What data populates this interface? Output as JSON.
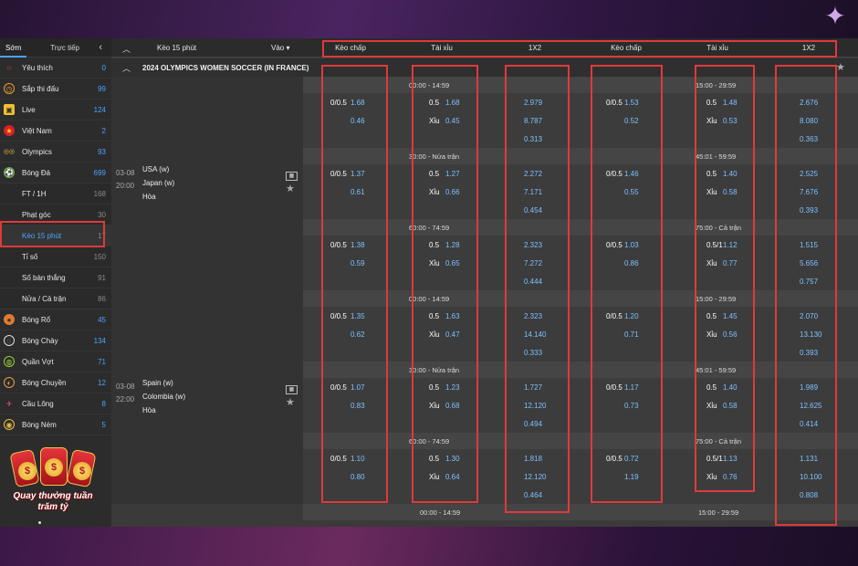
{
  "sidebar": {
    "tabs": [
      "Sớm",
      "Trực tiếp"
    ],
    "items": [
      {
        "label": "Yêu thích",
        "count": "0",
        "icon": "star-icon"
      },
      {
        "label": "Sắp thi đấu",
        "count": "99",
        "icon": "clock-icon"
      },
      {
        "label": "Live",
        "count": "124",
        "icon": "tv-icon"
      },
      {
        "label": "Việt Nam",
        "count": "2",
        "icon": "vietnam-flag-icon"
      },
      {
        "label": "Olympics",
        "count": "93",
        "icon": "olympic-rings-icon"
      },
      {
        "label": "Bóng Đá",
        "count": "699",
        "icon": "soccer-ball-icon"
      }
    ],
    "sub_items": [
      {
        "label": "FT / 1H",
        "count": "168"
      },
      {
        "label": "Phạt góc",
        "count": "30"
      },
      {
        "label": "Kèo 15 phút",
        "count": "17"
      },
      {
        "label": "Tỉ số",
        "count": "150"
      },
      {
        "label": "Số bàn thắng",
        "count": "91"
      },
      {
        "label": "Nửa / Cả trận",
        "count": "86"
      }
    ],
    "sports": [
      {
        "label": "Bóng Rổ",
        "count": "45",
        "icon": "basketball-icon"
      },
      {
        "label": "Bóng Chày",
        "count": "134",
        "icon": "baseball-icon"
      },
      {
        "label": "Quần Vợt",
        "count": "71",
        "icon": "tennis-icon"
      },
      {
        "label": "Bóng Chuyền",
        "count": "12",
        "icon": "volleyball-icon"
      },
      {
        "label": "Cầu Lông",
        "count": "8",
        "icon": "badminton-icon"
      },
      {
        "label": "Bóng Ném",
        "count": "5",
        "icon": "handball-icon"
      }
    ]
  },
  "promo": {
    "line1": "Quay thưởng tuần",
    "line2": "trăm tỷ"
  },
  "topbar": {
    "title": "Kèo 15 phút",
    "vao": "Vào",
    "columns": [
      "Kèo chấp",
      "Tài xỉu",
      "1X2",
      "Kèo chấp",
      "Tài xỉu",
      "1X2"
    ]
  },
  "league": "2024 OLYMPICS WOMEN SOCCER (IN FRANCE)",
  "matches": [
    {
      "date": "03-08",
      "time": "20:00",
      "home": "USA (w)",
      "away": "Japan (w)",
      "draw": "Hòa",
      "blocks": [
        {
          "left_period": "00:00 - 14:59",
          "right_period": "15:00 - 29:59",
          "l": {
            "hcap": "0/0.5",
            "h1": "1.68",
            "h2": "0.46",
            "ou": "0.5",
            "ou1": "1.68",
            "xiu": "Xỉu",
            "ou2": "0.45",
            "x1": "2.979",
            "x2": "8.787",
            "x3": "0.313"
          },
          "r": {
            "hcap": "0/0.5",
            "h1": "1.53",
            "h2": "0.52",
            "ou": "0.5",
            "ou1": "1.48",
            "xiu": "Xỉu",
            "ou2": "0.53",
            "x1": "2.676",
            "x2": "8.080",
            "x3": "0.363"
          }
        },
        {
          "left_period": "30:00 - Nửa trận",
          "right_period": "45:01 - 59:59",
          "l": {
            "hcap": "0/0.5",
            "h1": "1.37",
            "h2": "0.61",
            "ou": "0.5",
            "ou1": "1.27",
            "xiu": "Xỉu",
            "ou2": "0.66",
            "x1": "2.272",
            "x2": "7.171",
            "x3": "0.454"
          },
          "r": {
            "hcap": "0/0.5",
            "h1": "1.46",
            "h2": "0.55",
            "ou": "0.5",
            "ou1": "1.40",
            "xiu": "Xỉu",
            "ou2": "0.58",
            "x1": "2.525",
            "x2": "7.676",
            "x3": "0.393"
          }
        },
        {
          "left_period": "60:00 - 74:59",
          "right_period": "75:00 - Cả trận",
          "l": {
            "hcap": "0/0.5",
            "h1": "1.38",
            "h2": "0.59",
            "ou": "0.5",
            "ou1": "1.28",
            "xiu": "Xỉu",
            "ou2": "0.65",
            "x1": "2.323",
            "x2": "7.272",
            "x3": "0.444"
          },
          "r": {
            "hcap": "0/0.5",
            "h1": "1.03",
            "h2": "0.86",
            "ou": "0.5/1",
            "ou1": "1.12",
            "xiu": "Xỉu",
            "ou2": "0.77",
            "x1": "1.515",
            "x2": "5.656",
            "x3": "0.757"
          }
        }
      ]
    },
    {
      "date": "03-08",
      "time": "22:00",
      "home": "Spain (w)",
      "away": "Colombia (w)",
      "draw": "Hòa",
      "blocks": [
        {
          "left_period": "00:00 - 14:59",
          "right_period": "15:00 - 29:59",
          "l": {
            "hcap": "0/0.5",
            "h1": "1.35",
            "h2": "0.62",
            "ou": "0.5",
            "ou1": "1.63",
            "xiu": "Xỉu",
            "ou2": "0.47",
            "x1": "2.323",
            "x2": "14.140",
            "x3": "0.333"
          },
          "r": {
            "hcap": "0/0.5",
            "h1": "1.20",
            "h2": "0.71",
            "ou": "0.5",
            "ou1": "1.45",
            "xiu": "Xỉu",
            "ou2": "0.56",
            "x1": "2.070",
            "x2": "13.130",
            "x3": "0.393"
          }
        },
        {
          "left_period": "30:00 - Nửa trận",
          "right_period": "45:01 - 59:59",
          "l": {
            "hcap": "0/0.5",
            "h1": "1.07",
            "h2": "0.83",
            "ou": "0.5",
            "ou1": "1.23",
            "xiu": "Xỉu",
            "ou2": "0.68",
            "x1": "1.727",
            "x2": "12.120",
            "x3": "0.494"
          },
          "r": {
            "hcap": "0/0.5",
            "h1": "1.17",
            "h2": "0.73",
            "ou": "0.5",
            "ou1": "1.40",
            "xiu": "Xỉu",
            "ou2": "0.58",
            "x1": "1.989",
            "x2": "12.625",
            "x3": "0.414"
          }
        },
        {
          "left_period": "60:00 - 74:59",
          "right_period": "75:00 - Cả trận",
          "l": {
            "hcap": "0/0.5",
            "h1": "1.10",
            "h2": "0.80",
            "ou": "0.5",
            "ou1": "1.30",
            "xiu": "Xỉu",
            "ou2": "0.64",
            "x1": "1.818",
            "x2": "12.120",
            "x3": "0.464"
          },
          "r": {
            "hcap": "0/0.5",
            "h1": "0.72",
            "h2": "1.19",
            "ou": "0.5/1",
            "ou1": "1.13",
            "xiu": "Xỉu",
            "ou2": "0.76",
            "x1": "1.131",
            "x2": "10.100",
            "x3": "0.808"
          }
        }
      ]
    }
  ],
  "trailing_period": {
    "left": "00:00 - 14:59",
    "right": "15:00 - 29:59"
  },
  "colors": {
    "highlight": "#e0393b",
    "odds": "#7ec0ff",
    "accent": "#4aa3ff"
  }
}
